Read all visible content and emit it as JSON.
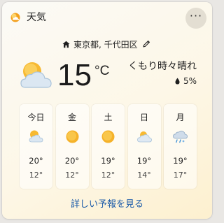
{
  "header": {
    "title": "天気",
    "more_label": "···"
  },
  "location": {
    "name": "東京都, 千代田区"
  },
  "current": {
    "temperature": "15",
    "unit": "°C",
    "condition": "くもり時々晴れ",
    "precipitation": "5%"
  },
  "forecast": [
    {
      "day": "今日",
      "icon": "partly-sunny-icon",
      "high": "20°",
      "low": "12°"
    },
    {
      "day": "金",
      "icon": "sunny-icon",
      "high": "20°",
      "low": "12°"
    },
    {
      "day": "土",
      "icon": "sunny-icon",
      "high": "19°",
      "low": "12°"
    },
    {
      "day": "日",
      "icon": "partly-cloudy-icon",
      "high": "19°",
      "low": "14°"
    },
    {
      "day": "月",
      "icon": "cloudy-sleet-icon",
      "high": "19°",
      "low": "17°"
    }
  ],
  "footer": {
    "link_label": "詳しい予報を見る"
  },
  "colors": {
    "link": "#1a5aa8",
    "sun": "#f5b72a",
    "cloud": "#cfe0ee",
    "accent": "#f0a020"
  }
}
